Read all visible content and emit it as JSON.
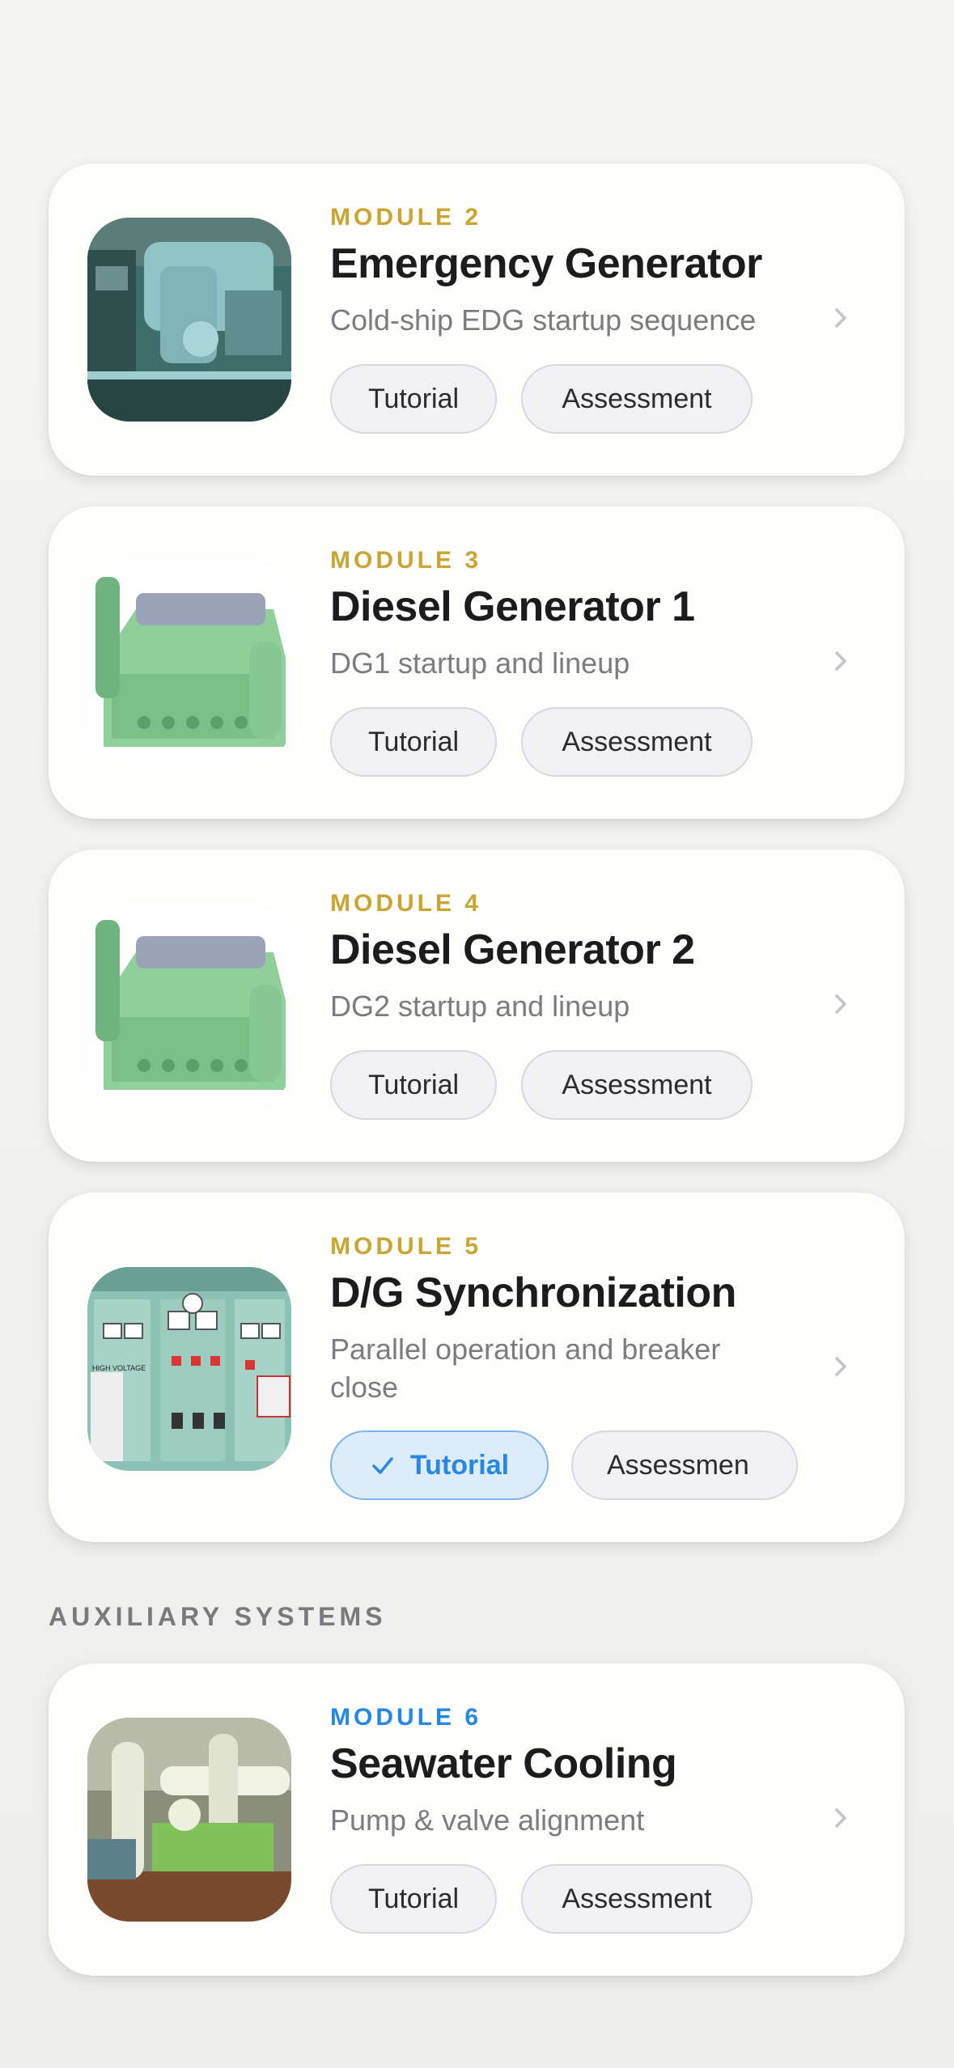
{
  "modules": [
    {
      "module_label": "MODULE 2",
      "title": "Emergency Generator",
      "subtitle": "Cold-ship EDG startup sequence",
      "tutorial_label": "Tutorial",
      "assessment_label": "Assessment",
      "image": "emergency-generator-photo"
    },
    {
      "module_label": "MODULE 3",
      "title": "Diesel Generator 1",
      "subtitle": "DG1 startup and lineup",
      "tutorial_label": "Tutorial",
      "assessment_label": "Assessment",
      "image": "diesel-generator-photo"
    },
    {
      "module_label": "MODULE 4",
      "title": "Diesel Generator 2",
      "subtitle": "DG2 startup and lineup",
      "tutorial_label": "Tutorial",
      "assessment_label": "Assessment",
      "image": "diesel-generator-photo"
    },
    {
      "module_label": "MODULE 5",
      "title": "D/G Synchronization",
      "subtitle": "Parallel operation and breaker close",
      "tutorial_label": "Tutorial",
      "tutorial_completed": true,
      "assessment_label": "Assessmen",
      "image": "switchboard-photo",
      "panel_text": "HIGH VOLTAGE"
    }
  ],
  "section_header": "AUXILIARY SYSTEMS",
  "aux_modules": [
    {
      "module_label": "MODULE 6",
      "title": "Seawater Cooling",
      "subtitle": "Pump & valve alignment",
      "tutorial_label": "Tutorial",
      "assessment_label": "Assessment",
      "image": "pump-room-photo"
    }
  ],
  "colors": {
    "module_label_gold": "#c9a531",
    "module_label_blue": "#2287e6",
    "completed_accent": "#2787e2"
  },
  "icons": {
    "chevron": "chevron-right-icon",
    "check": "checkmark-icon"
  }
}
